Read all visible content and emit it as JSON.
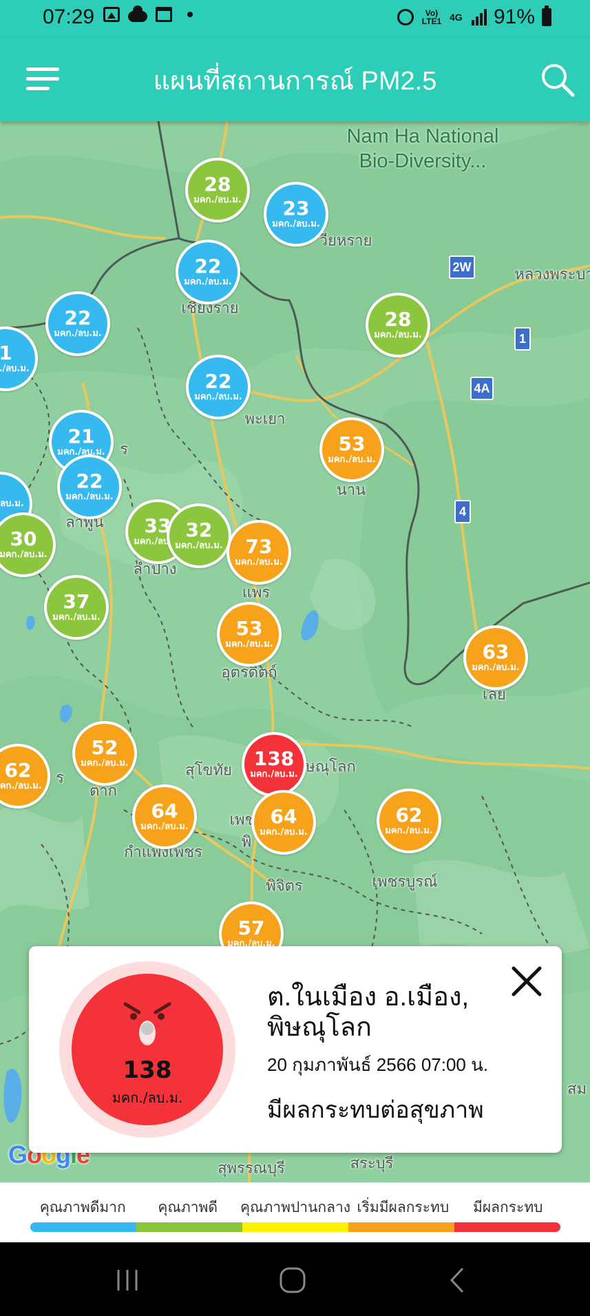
{
  "status_bar": {
    "time": "07:29",
    "volte": "Vo) LTE1",
    "network": "4G",
    "battery": "91%"
  },
  "app": {
    "title": "แผนที่สถานการณ์ PM2.5"
  },
  "map": {
    "park_label": "Nam Ha National Bio-Diversity...",
    "places": [
      {
        "text": "เชียงราย"
      },
      {
        "text": "วียหราย"
      },
      {
        "text": "หลวงพระบา"
      },
      {
        "text": "พะเยา"
      },
      {
        "text": "นาน"
      },
      {
        "text": "ลาพูน"
      },
      {
        "text": "ลำปาง"
      },
      {
        "text": "แพร"
      },
      {
        "text": "อุตรดิตถ์"
      },
      {
        "text": "เลย"
      },
      {
        "text": "สุโขทัย"
      },
      {
        "text": "ษณุโลก"
      },
      {
        "text": "เพช"
      },
      {
        "text": "พิ"
      },
      {
        "text": "กำแพงเพชร"
      },
      {
        "text": "พิจิตร"
      },
      {
        "text": "เพชรบูรณ์"
      },
      {
        "text": "ตาก"
      },
      {
        "text": "ร"
      },
      {
        "text": "ร"
      },
      {
        "text": "สุพรรณบุรี"
      },
      {
        "text": "สระบุรี"
      },
      {
        "text": "สม"
      }
    ],
    "shields": [
      {
        "text": "2W"
      },
      {
        "text": "1"
      },
      {
        "text": "4A"
      },
      {
        "text": "4"
      }
    ],
    "google_logo": "Google",
    "unit": "มคก./ลบ.ม.",
    "markers": [
      {
        "value": "28",
        "level": "good"
      },
      {
        "value": "23",
        "level": "very_good"
      },
      {
        "value": "22",
        "level": "very_good"
      },
      {
        "value": "28",
        "level": "good"
      },
      {
        "value": "22",
        "level": "very_good"
      },
      {
        "value": "1",
        "level": "very_good"
      },
      {
        "value": "22",
        "level": "very_good"
      },
      {
        "value": "21",
        "level": "very_good"
      },
      {
        "value": "22",
        "level": "very_good"
      },
      {
        "value": "53",
        "level": "starting"
      },
      {
        "value": "",
        "level": "very_good"
      },
      {
        "value": "30",
        "level": "good"
      },
      {
        "value": "37",
        "level": "good"
      },
      {
        "value": "33",
        "level": "good"
      },
      {
        "value": "32",
        "level": "good"
      },
      {
        "value": "73",
        "level": "starting"
      },
      {
        "value": "53",
        "level": "starting"
      },
      {
        "value": "63",
        "level": "starting"
      },
      {
        "value": "62",
        "level": "starting"
      },
      {
        "value": "52",
        "level": "starting"
      },
      {
        "value": "138",
        "level": "impact"
      },
      {
        "value": "64",
        "level": "starting"
      },
      {
        "value": "64",
        "level": "starting"
      },
      {
        "value": "62",
        "level": "starting"
      },
      {
        "value": "57",
        "level": "starting"
      }
    ]
  },
  "colors": {
    "very_good": "#35b9ee",
    "good": "#8cc63f",
    "moderate": "#fff200",
    "starting": "#f7a21b",
    "impact": "#f4323a",
    "header": "#2dcdb8"
  },
  "info_card": {
    "value": "138",
    "unit": "มคก./ลบ.ม.",
    "location_line1": "ต.ในเมือง อ.เมือง,",
    "location_line2": "พิษณุโลก",
    "date": "20 กุมภาพันธ์ 2566  07:00 น.",
    "status": "มีผลกระทบต่อสุขภาพ",
    "face_icon": "angry-face-icon",
    "close_icon": "close-icon"
  },
  "legend": {
    "labels": [
      "คุณภาพดีมาก",
      "คุณภาพดี",
      "คุณภาพปานกลาง",
      "เริ่มมีผลกระทบ",
      "มีผลกระทบ"
    ]
  },
  "nav": {
    "recent_icon": "recent-apps-icon",
    "home_icon": "home-icon",
    "back_icon": "back-icon"
  }
}
